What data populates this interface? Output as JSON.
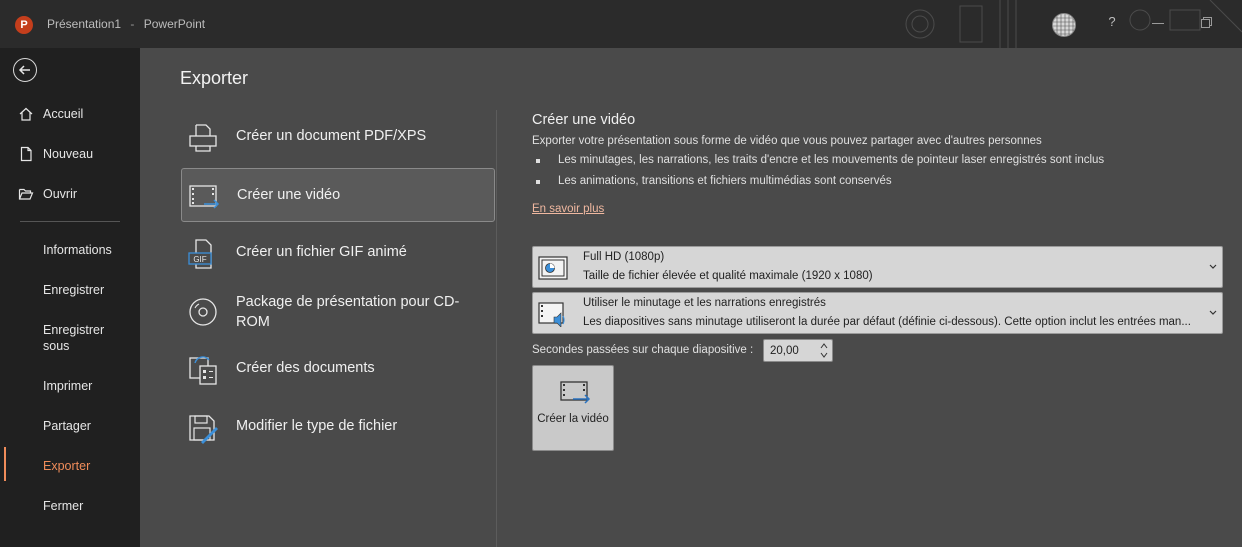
{
  "titlebar": {
    "app_icon_letter": "P",
    "document": "Présentation1",
    "separator": "-",
    "app": "PowerPoint",
    "help": "?"
  },
  "sidebar": {
    "items": [
      {
        "label": "Accueil",
        "icon": "home-icon"
      },
      {
        "label": "Nouveau",
        "icon": "new-document-icon"
      },
      {
        "label": "Ouvrir",
        "icon": "open-folder-icon"
      },
      {
        "label": "Informations"
      },
      {
        "label": "Enregistrer"
      },
      {
        "label": "Enregistrer sous"
      },
      {
        "label": "Imprimer"
      },
      {
        "label": "Partager"
      },
      {
        "label": "Exporter",
        "active": true
      },
      {
        "label": "Fermer"
      }
    ],
    "accent_color": "#f08c5a"
  },
  "main": {
    "title": "Exporter",
    "options": [
      {
        "label": "Créer un document PDF/XPS",
        "icon": "pdf-document-icon"
      },
      {
        "label": "Créer une vidéo",
        "icon": "video-icon",
        "selected": true
      },
      {
        "label": "Créer un fichier GIF animé",
        "icon": "gif-icon",
        "icon_text": "GIF"
      },
      {
        "label": "Package de présentation pour CD-ROM",
        "icon": "cd-icon"
      },
      {
        "label": "Créer des documents",
        "icon": "handouts-icon"
      },
      {
        "label": "Modifier le type de fichier",
        "icon": "change-file-type-icon"
      }
    ]
  },
  "panel": {
    "title": "Créer une vidéo",
    "description": "Exporter votre présentation sous forme de vidéo que vous pouvez partager avec d'autres personnes",
    "bullets": [
      "Les minutages, les narrations, les traits d'encre et les mouvements de pointeur laser enregistrés sont inclus",
      "Les animations, transitions et fichiers multimédias sont conservés"
    ],
    "learn_more": "En savoir plus",
    "quality_dropdown": {
      "title": "Full HD (1080p)",
      "subtitle": "Taille de fichier élevée et qualité maximale (1920 x 1080)"
    },
    "timing_dropdown": {
      "title": "Utiliser le minutage et les narrations enregistrés",
      "subtitle": "Les diapositives sans minutage utiliseront la durée par défaut (définie ci-dessous). Cette option inclut les entrées man..."
    },
    "seconds_label": "Secondes passées sur chaque diapositive :",
    "seconds_value": "20,00",
    "create_button": "Créer la vidéo"
  }
}
